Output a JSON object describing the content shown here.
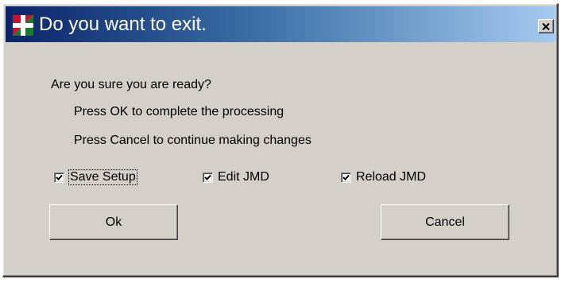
{
  "window": {
    "title": "Do you want to exit.",
    "icon": "red-cross-app-icon",
    "close_icon": "close-icon"
  },
  "message": {
    "line1": "Are you sure you are ready?",
    "line2": "Press OK to complete the processing",
    "line3": "Press Cancel to continue making changes"
  },
  "options": [
    {
      "label": "Save Setup",
      "checked": true
    },
    {
      "label": "Edit JMD",
      "checked": true
    },
    {
      "label": "Reload JMD",
      "checked": true
    }
  ],
  "buttons": {
    "ok_label": "Ok",
    "cancel_label": "Cancel"
  },
  "colors": {
    "title_gradient_start": "#0a246a",
    "title_gradient_end": "#a6caf0",
    "dialog_background": "#d4d0c8"
  }
}
